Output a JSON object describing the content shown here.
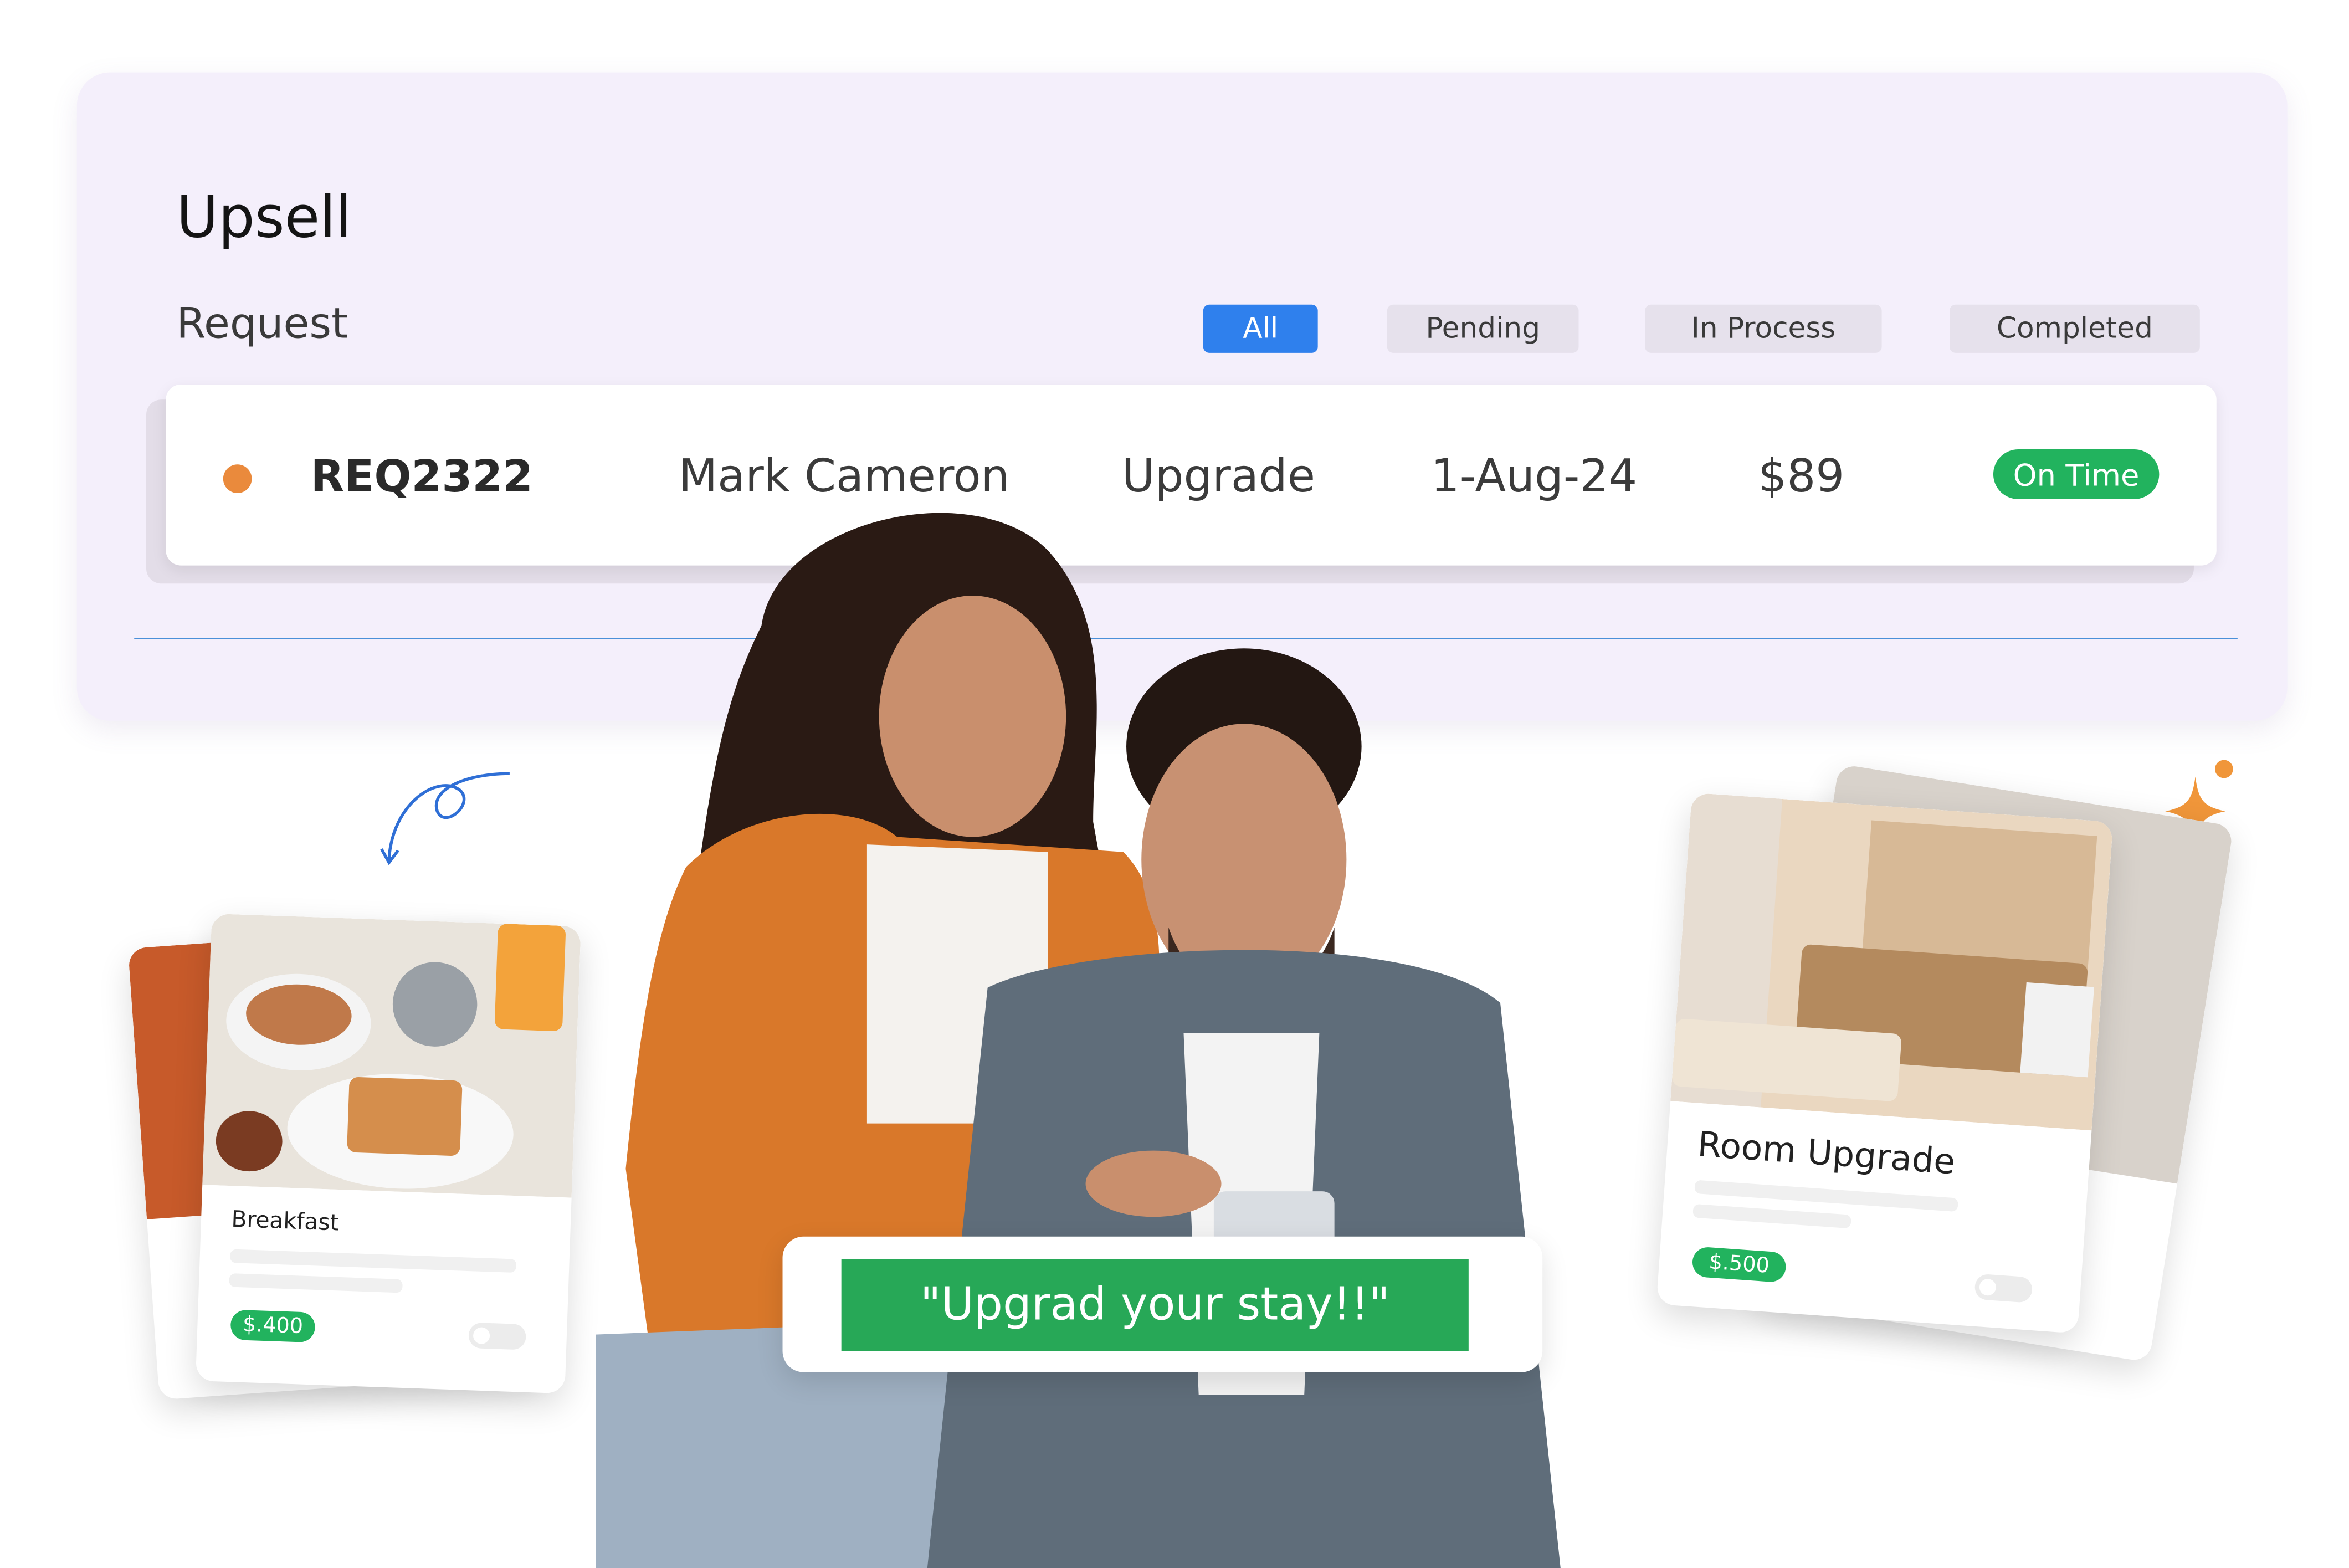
{
  "panel": {
    "title": "Upsell",
    "subtitle": "Request",
    "filters": [
      {
        "label": "All",
        "active": true
      },
      {
        "label": "Pending",
        "active": false
      },
      {
        "label": "In Process",
        "active": false
      },
      {
        "label": "Completed",
        "active": false
      }
    ],
    "request": {
      "id": "REQ2322",
      "guest": "Mark Cameron",
      "type": "Upgrade",
      "date": "1-Aug-24",
      "amount": "$89",
      "status": "On Time",
      "status_color": "#22b35e",
      "dot_color": "#ea8a3c"
    }
  },
  "cards": {
    "breakfast": {
      "label": "Breakfast",
      "price": "$.400"
    },
    "room": {
      "label": "Room Upgrade",
      "price": "$.500"
    }
  },
  "banner": {
    "text": "\"Upgrad your stay!!\""
  },
  "icons": {
    "curl_arrow": "curl-arrow-icon",
    "sparkle": "sparkle-icon"
  },
  "colors": {
    "accent_blue": "#2f80ed",
    "accent_green": "#22b35e",
    "accent_orange": "#ea8a3c"
  }
}
